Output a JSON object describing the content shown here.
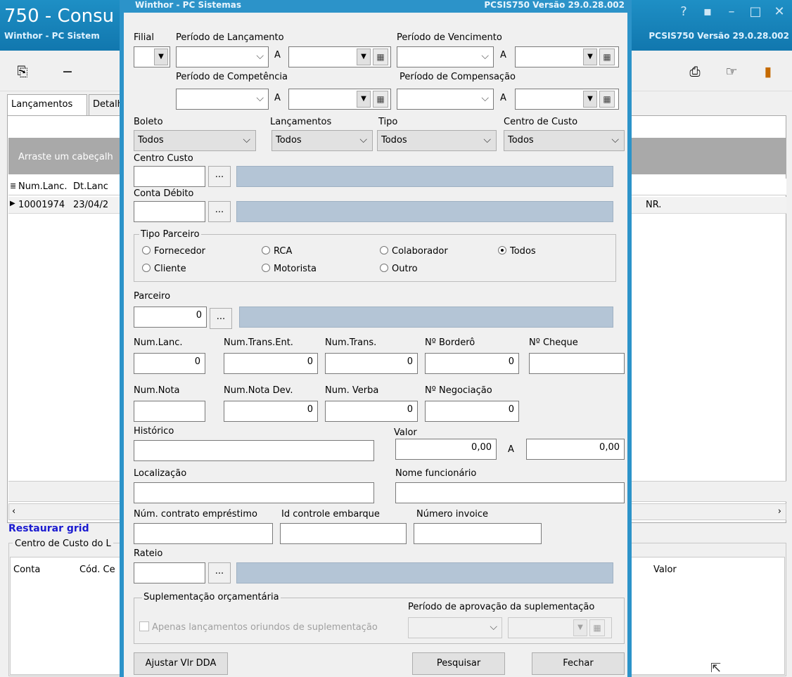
{
  "background_window": {
    "title": "750 - Consu",
    "subtitle": "Winthor - PC Sistem",
    "subtitle_right": "PCSIS750  Versão  29.0.28.002",
    "tabs": [
      "Lançamentos",
      "Detalh"
    ],
    "group_header": "Arraste um cabeçalh",
    "grid_headers": [
      "Num.Lanc.",
      "Dt.Lanc"
    ],
    "grid_row": [
      "10001974",
      "23/04/2"
    ],
    "row_tail": "NR.",
    "restore_grid": "Restaurar grid",
    "cost_center_group": "Centro de Custo do L",
    "cost_center_headers": [
      "Conta",
      "Cód. Ce"
    ],
    "value_header": "Valor"
  },
  "dialog": {
    "title": "Winthor - PC Sistemas",
    "title_right": "PCSIS750   Versão  29.0.28.002",
    "labels": {
      "filial": "Filial",
      "periodo_lancamento": "Período de Lançamento",
      "periodo_vencimento": "Período de Vencimento",
      "periodo_competencia": "Período de Competência",
      "periodo_compensacao": "Período de Compensação",
      "a": "A",
      "boleto": "Boleto",
      "lancamentos": "Lançamentos",
      "tipo": "Tipo",
      "centro_de_custo": "Centro de Custo",
      "centro_custo": "Centro Custo",
      "conta_debito": "Conta Débito",
      "tipo_parceiro": "Tipo Parceiro",
      "parceiro": "Parceiro",
      "num_lanc": "Num.Lanc.",
      "num_trans_ent": "Num.Trans.Ent.",
      "num_trans": "Num.Trans.",
      "num_bordero": "Nº Borderô",
      "num_cheque": "Nº Cheque",
      "num_nota": "Num.Nota",
      "num_nota_dev": "Num.Nota Dev.",
      "num_verba": "Num. Verba",
      "num_negociacao": "Nº Negociação",
      "historico": "Histórico",
      "valor": "Valor",
      "localizacao": "Localização",
      "nome_funcionario": "Nome funcionário",
      "num_contrato": "Núm. contrato empréstimo",
      "id_controle": "Id controle embarque",
      "numero_invoice": "Número invoice",
      "rateio": "Rateio",
      "suplementacao": "Suplementação orçamentária",
      "periodo_aprovacao": "Período de aprovação da suplementação",
      "apenas_lancamentos": "Apenas lançamentos oriundos de suplementação"
    },
    "combos": {
      "boleto": "Todos",
      "lancamentos": "Todos",
      "tipo": "Todos",
      "centro_de_custo": "Todos"
    },
    "radios": {
      "fornecedor": "Fornecedor",
      "rca": "RCA",
      "colaborador": "Colaborador",
      "todos": "Todos",
      "cliente": "Cliente",
      "motorista": "Motorista",
      "outro": "Outro"
    },
    "values": {
      "parceiro": "0",
      "num_lanc": "0",
      "num_trans_ent": "0",
      "num_trans": "0",
      "num_bordero": "0",
      "num_nota_dev": "0",
      "num_verba": "0",
      "num_negociacao": "0",
      "valor_de": "0,00",
      "valor_ate": "0,00"
    },
    "buttons": {
      "ajustar": "Ajustar Vlr DDA",
      "pesquisar": "Pesquisar",
      "fechar": "Fechar",
      "ellipsis": "..."
    }
  }
}
